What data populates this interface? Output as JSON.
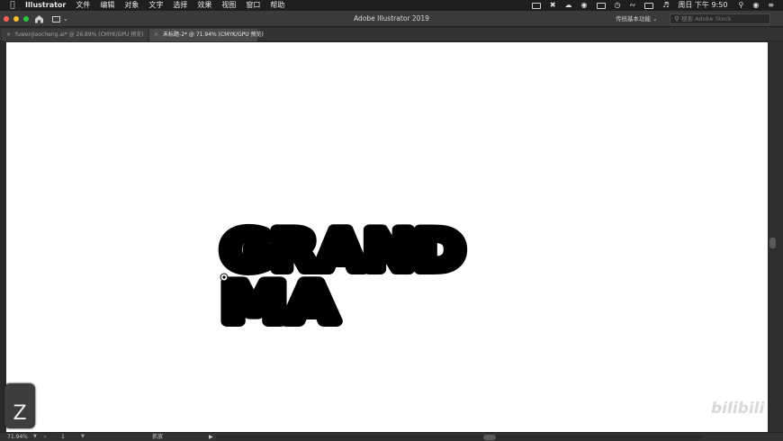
{
  "menubar": {
    "apple_icon": "apple-icon",
    "app_name": "Illustrator",
    "items": [
      "文件",
      "编辑",
      "对象",
      "文字",
      "选择",
      "效果",
      "视图",
      "窗口",
      "帮助"
    ],
    "clock": "周日 下午 9:50"
  },
  "window": {
    "title": "Adobe Illustrator 2019",
    "workspace": "传统基本功能",
    "search_placeholder": "搜索 Adobe Stock"
  },
  "tabs": [
    {
      "label": "fuwenjiaocheng.ai* @ 26.89% (CMYK/GPU 预览)",
      "close": "×"
    },
    {
      "label": "未标题-2* @ 71.94% (CMYK/GPU 预览)",
      "close": "×"
    }
  ],
  "artwork": {
    "line1": "GRAND",
    "line2": "MA",
    "fill": "#000000"
  },
  "key_badge": "Z",
  "watermark": "bilibili",
  "statusbar": {
    "zoom": "71.94%",
    "page": "1",
    "mode": "抓放"
  },
  "colors": {
    "menubar": "#1e1e1e",
    "chrome": "#3a3a3a",
    "artboard": "#ffffff",
    "close": "#ff5f57",
    "minimize": "#febc2e",
    "zoom": "#28c840"
  }
}
